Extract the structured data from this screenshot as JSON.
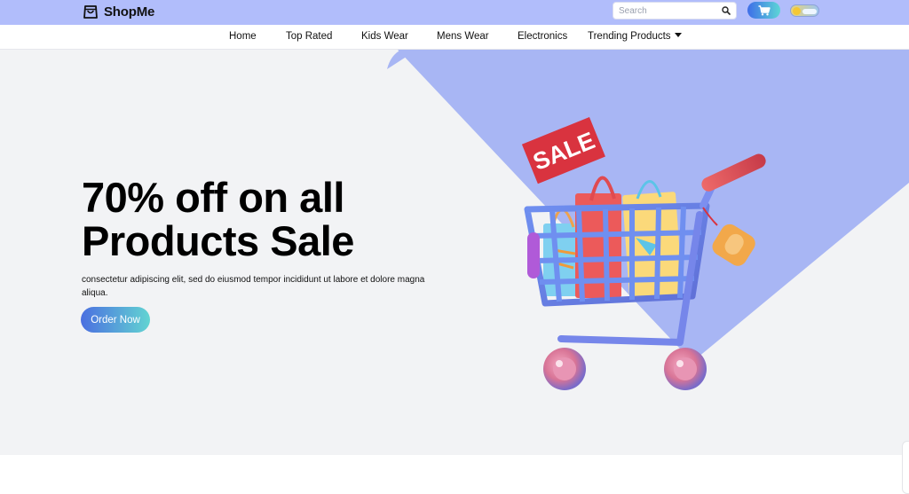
{
  "header": {
    "brand": "ShopMe",
    "logo_icon": "shopping-bag-icon",
    "search": {
      "placeholder": "Search",
      "value": ""
    },
    "cart_icon": "cart-icon",
    "theme_toggle_icon": "sun-cloud-icon"
  },
  "nav": {
    "items": [
      {
        "label": "Home"
      },
      {
        "label": "Top Rated"
      },
      {
        "label": "Kids Wear"
      },
      {
        "label": "Mens Wear"
      },
      {
        "label": "Electronics"
      },
      {
        "label": "Trending Products"
      }
    ],
    "dropdown_icon": "caret-down-icon"
  },
  "hero": {
    "title_line1": "70% off on all",
    "title_line2": "Products Sale",
    "description": "consectetur adipiscing elit, sed do eiusmod tempor incididunt ut labore et dolore magna aliqua.",
    "button_label": "Order Now",
    "sale_tag": "SALE"
  },
  "colors": {
    "topbar": "#b1bdfb",
    "hero_bg": "#f2f3f5",
    "hero_accent": "#a8b6f4",
    "button_start": "#4b6fe0",
    "button_end": "#62d4d2",
    "sale_red": "#d9333f"
  }
}
